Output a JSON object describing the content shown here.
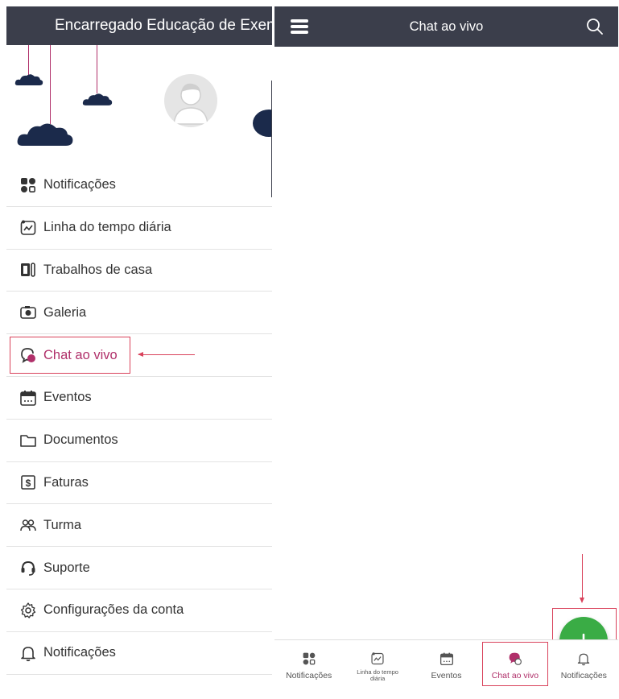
{
  "drawer": {
    "header_title": "Encarregado Educação de Exemplo",
    "menu_items": [
      {
        "label": "Notificações",
        "icon": "dashboard-icon"
      },
      {
        "label": "Linha do tempo diária",
        "icon": "timeline-icon"
      },
      {
        "label": "Trabalhos de casa",
        "icon": "homework-icon"
      },
      {
        "label": "Galeria",
        "icon": "camera-icon"
      },
      {
        "label": "Chat ao vivo",
        "icon": "chat-icon",
        "active": true
      },
      {
        "label": "Eventos",
        "icon": "calendar-icon"
      },
      {
        "label": "Documentos",
        "icon": "folder-icon"
      },
      {
        "label": "Faturas",
        "icon": "invoice-icon"
      },
      {
        "label": "Turma",
        "icon": "people-icon"
      },
      {
        "label": "Suporte",
        "icon": "headset-icon"
      },
      {
        "label": "Configurações da conta",
        "icon": "gear-icon"
      },
      {
        "label": "Notificações",
        "icon": "bell-icon"
      }
    ]
  },
  "chat": {
    "header_title": "Chat ao vivo",
    "fab_icon": "plus-icon"
  },
  "tabbar": {
    "tabs": [
      {
        "label": "Notificações",
        "icon": "dashboard-icon"
      },
      {
        "label": "Linha do tempo diária",
        "icon": "timeline-icon"
      },
      {
        "label": "Eventos",
        "icon": "calendar-icon"
      },
      {
        "label": "Chat ao vivo",
        "icon": "chat-icon",
        "active": true
      },
      {
        "label": "Notificações",
        "icon": "bell-icon"
      }
    ]
  },
  "colors": {
    "header_bg": "#3b3e4b",
    "accent": "#b0306a",
    "fab": "#3aac45",
    "annotation": "#d9425b",
    "cloud": "#1b2a4b"
  }
}
